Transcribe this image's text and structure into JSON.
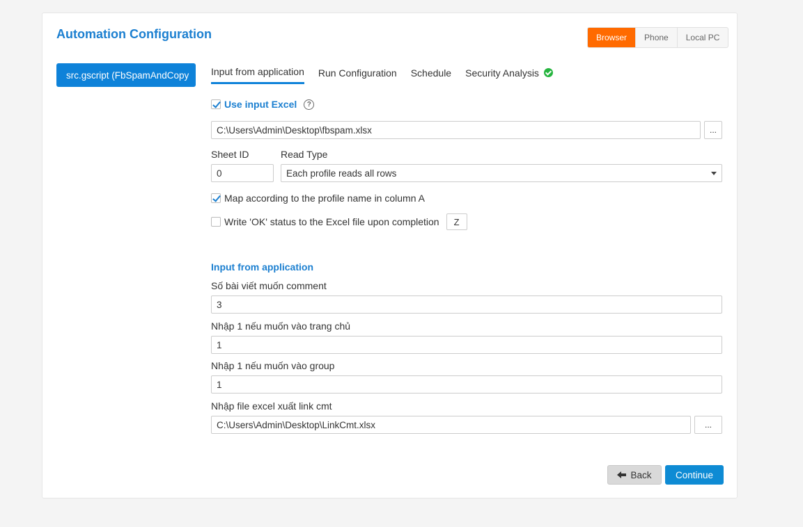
{
  "page": {
    "title": "Automation Configuration"
  },
  "platforms": [
    "Browser",
    "Phone",
    "Local PC"
  ],
  "platform_active": "Browser",
  "script_tab": {
    "label": "src.gscript   (FbSpamAndCopy"
  },
  "tabs": [
    "Input from application",
    "Run Configuration",
    "Schedule",
    "Security Analysis"
  ],
  "excel": {
    "use_label": "Use input Excel",
    "help_glyph": "?",
    "path": "C:\\Users\\Admin\\Desktop\\fbspam.xlsx",
    "browse_label": "...",
    "sheet_id_label": "Sheet ID",
    "sheet_id": "0",
    "read_type_label": "Read Type",
    "read_type": "Each profile reads all rows",
    "map_label": "Map according to the profile name in column A",
    "write_ok_label": "Write 'OK' status to the Excel file upon completion",
    "write_col": "Z"
  },
  "app_inputs": {
    "section_title": "Input from application",
    "fields": [
      {
        "label": "Số bài viết muốn comment",
        "value": "3"
      },
      {
        "label": "Nhập 1 nếu muốn vào trang chủ",
        "value": "1"
      },
      {
        "label": "Nhập 1 nếu muốn vào group",
        "value": "1"
      },
      {
        "label": "Nhập file excel xuất link cmt",
        "value": "C:\\Users\\Admin\\Desktop\\LinkCmt.xlsx",
        "browse_label": "..."
      }
    ]
  },
  "footer": {
    "back_label": "Back",
    "continue_label": "Continue"
  },
  "colors": {
    "accent": "#0e82d9",
    "active_platform": "#ff6a00",
    "ok": "#26b53f"
  }
}
